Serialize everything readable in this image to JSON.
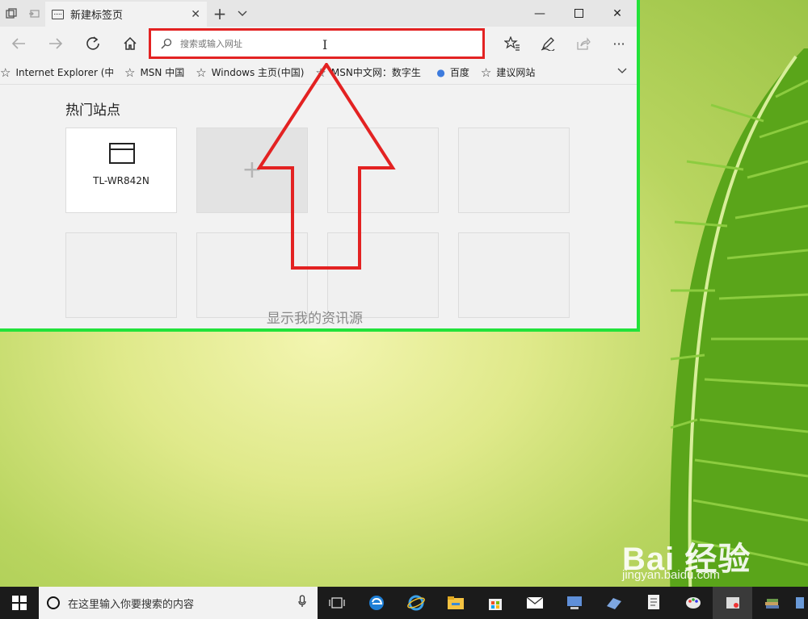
{
  "browser": {
    "tab_title": "新建标签页",
    "address_placeholder": "搜索或输入网址",
    "favorites": [
      {
        "label": "Internet Explorer (中目",
        "icon": "star-icon"
      },
      {
        "label": "MSN 中国",
        "icon": "star-icon"
      },
      {
        "label": "Windows 主页(中国)",
        "icon": "star-icon"
      },
      {
        "label": "MSN中文网：数字生",
        "icon": "star-icon"
      },
      {
        "label": "百度",
        "icon": "paw-icon"
      },
      {
        "label": "建议网站",
        "icon": "star-icon"
      }
    ],
    "top_sites_title": "热门站点",
    "top_sites": [
      {
        "label": "TL-WR842N"
      }
    ],
    "show_feed": "显示我的资讯源"
  },
  "taskbar": {
    "search_placeholder": "在这里输入你要搜索的内容"
  },
  "watermark": {
    "logo": "Bai 经验",
    "url": "jingyan.baidu.com"
  },
  "colors": {
    "highlight_border": "#22e23a",
    "annotation_red": "#e32222",
    "taskbar_bg": "#1b1b1b"
  }
}
